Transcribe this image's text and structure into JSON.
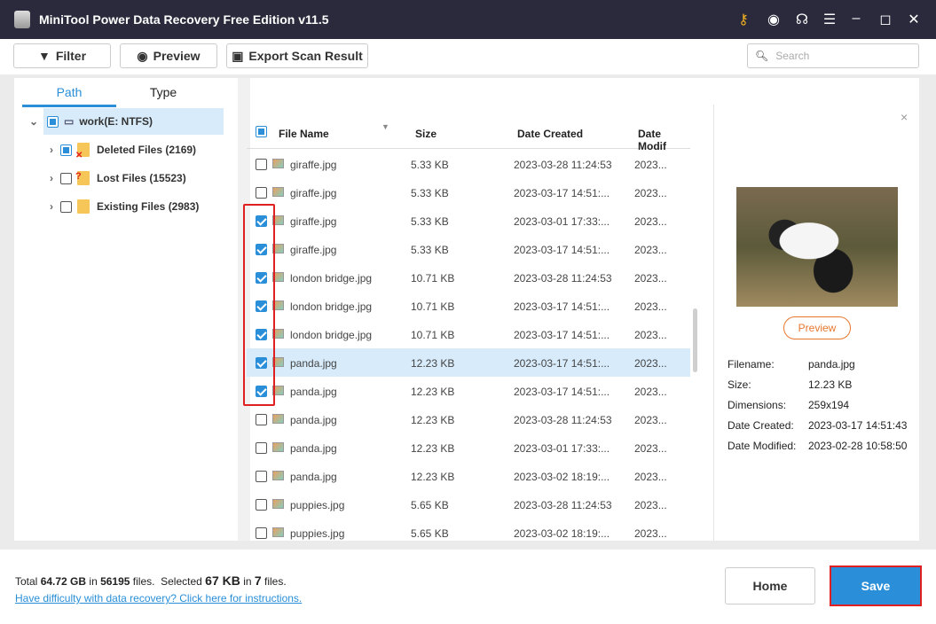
{
  "app": {
    "title": "MiniTool Power Data Recovery Free Edition v11.5"
  },
  "toolbar": {
    "filter": "Filter",
    "preview": "Preview",
    "export": "Export Scan Result",
    "search_placeholder": "Search"
  },
  "tabs": [
    "Path",
    "Type"
  ],
  "tree": [
    {
      "label": "work(E: NTFS)"
    },
    {
      "label": "Deleted Files (2169)"
    },
    {
      "label": "Lost Files (15523)"
    },
    {
      "label": "Existing Files (2983)"
    }
  ],
  "columns": [
    "File Name",
    "Size",
    "Date Created",
    "Date Modif"
  ],
  "rows": [
    {
      "name": "giraffe.jpg",
      "size": "5.33 KB",
      "created": "2023-03-28 11:24:53",
      "modified": "2023...",
      "checked": false
    },
    {
      "name": "giraffe.jpg",
      "size": "5.33 KB",
      "created": "2023-03-17 14:51:...",
      "modified": "2023...",
      "checked": false
    },
    {
      "name": "giraffe.jpg",
      "size": "5.33 KB",
      "created": "2023-03-01 17:33:...",
      "modified": "2023...",
      "checked": true
    },
    {
      "name": "giraffe.jpg",
      "size": "5.33 KB",
      "created": "2023-03-17 14:51:...",
      "modified": "2023...",
      "checked": true
    },
    {
      "name": "london bridge.jpg",
      "size": "10.71 KB",
      "created": "2023-03-28 11:24:53",
      "modified": "2023...",
      "checked": true
    },
    {
      "name": "london bridge.jpg",
      "size": "10.71 KB",
      "created": "2023-03-17 14:51:...",
      "modified": "2023...",
      "checked": true
    },
    {
      "name": "london bridge.jpg",
      "size": "10.71 KB",
      "created": "2023-03-17 14:51:...",
      "modified": "2023...",
      "checked": true
    },
    {
      "name": "panda.jpg",
      "size": "12.23 KB",
      "created": "2023-03-17 14:51:...",
      "modified": "2023...",
      "checked": true,
      "selected": true
    },
    {
      "name": "panda.jpg",
      "size": "12.23 KB",
      "created": "2023-03-17 14:51:...",
      "modified": "2023...",
      "checked": true
    },
    {
      "name": "panda.jpg",
      "size": "12.23 KB",
      "created": "2023-03-28 11:24:53",
      "modified": "2023...",
      "checked": false
    },
    {
      "name": "panda.jpg",
      "size": "12.23 KB",
      "created": "2023-03-01 17:33:...",
      "modified": "2023...",
      "checked": false
    },
    {
      "name": "panda.jpg",
      "size": "12.23 KB",
      "created": "2023-03-02 18:19:...",
      "modified": "2023...",
      "checked": false
    },
    {
      "name": "puppies.jpg",
      "size": "5.65 KB",
      "created": "2023-03-28 11:24:53",
      "modified": "2023...",
      "checked": false
    },
    {
      "name": "puppies.jpg",
      "size": "5.65 KB",
      "created": "2023-03-02 18:19:...",
      "modified": "2023...",
      "checked": false
    }
  ],
  "preview": {
    "button": "Preview",
    "close": "×",
    "info": [
      {
        "label": "Filename:",
        "value": "panda.jpg"
      },
      {
        "label": "Size:",
        "value": "12.23 KB"
      },
      {
        "label": "Dimensions:",
        "value": "259x194"
      },
      {
        "label": "Date Created:",
        "value": "2023-03-17 14:51:43"
      },
      {
        "label": "Date Modified:",
        "value": "2023-02-28 10:58:50"
      }
    ]
  },
  "footer": {
    "t1": "Total ",
    "total_size": "64.72 GB",
    "t2": " in ",
    "total_files": "56195",
    "t3": " files.  Selected ",
    "sel_size": "67 KB",
    "t4": " in ",
    "sel_files": "7",
    "t5": " files.",
    "help": "Have difficulty with data recovery? Click here for instructions.",
    "home": "Home",
    "save": "Save"
  }
}
